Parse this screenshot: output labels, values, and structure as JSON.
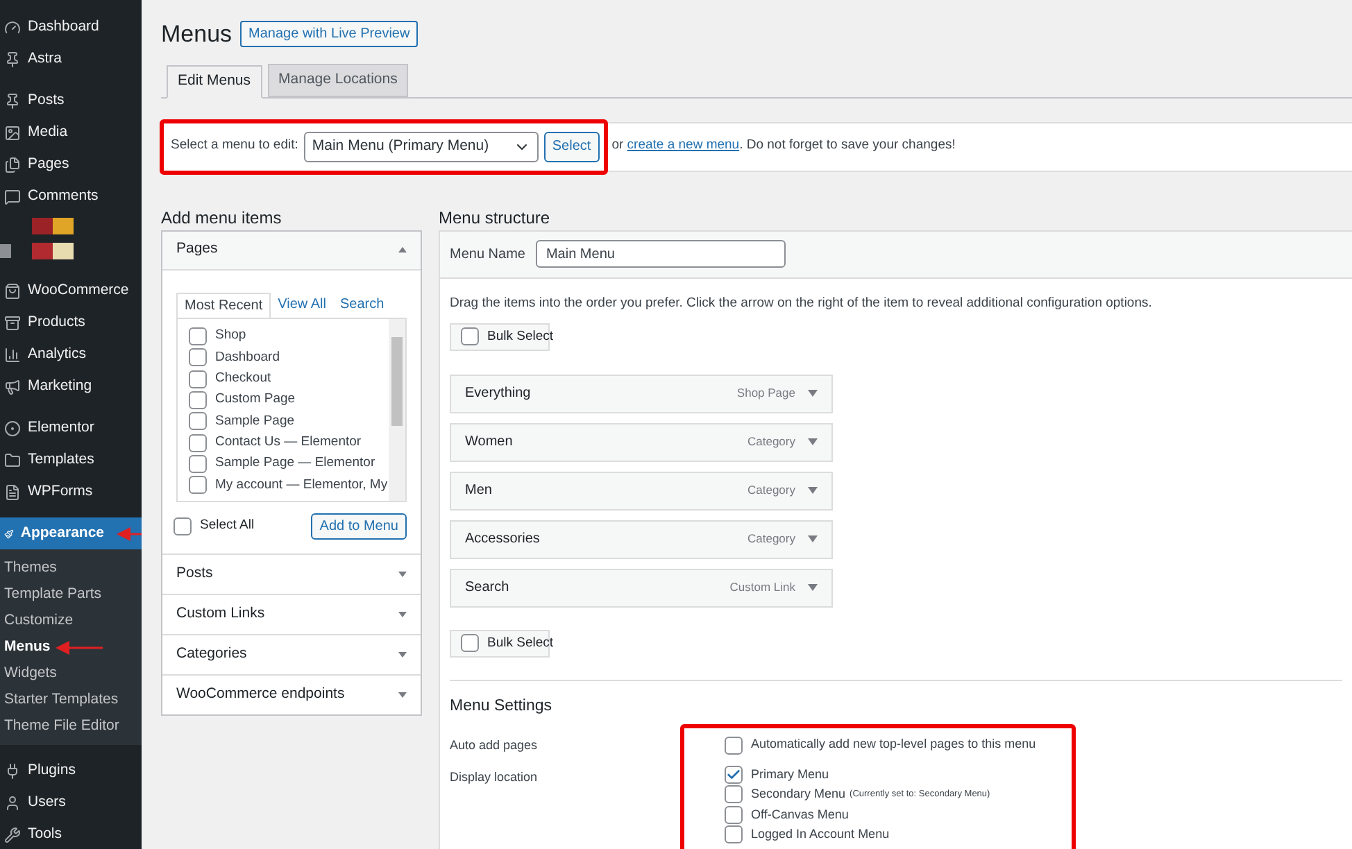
{
  "sidebar": {
    "sections": [
      [
        {
          "label": "Dashboard",
          "selected": false
        },
        {
          "label": "Astra",
          "selected": false
        }
      ],
      [
        {
          "label": "Posts",
          "selected": false
        },
        {
          "label": "Media",
          "selected": false
        },
        {
          "label": "Pages",
          "selected": false
        },
        {
          "label": "Comments",
          "selected": false
        }
      ],
      [
        {
          "label": "WooCommerce",
          "selected": false
        },
        {
          "label": "Products",
          "selected": false
        },
        {
          "label": "Analytics",
          "selected": false
        },
        {
          "label": "Marketing",
          "selected": false
        }
      ],
      [
        {
          "label": "Elementor",
          "selected": false
        },
        {
          "label": "Templates",
          "selected": false
        },
        {
          "label": "WPForms",
          "selected": false
        }
      ],
      [
        {
          "label": "Appearance",
          "selected": true,
          "arrow": true,
          "children": [
            {
              "label": "Themes",
              "selected": false,
              "arrow": false
            },
            {
              "label": "Template Parts",
              "selected": false,
              "arrow": false
            },
            {
              "label": "Customize",
              "selected": false,
              "arrow": false
            },
            {
              "label": "Menus",
              "selected": true,
              "arrow": true
            },
            {
              "label": "Widgets",
              "selected": false,
              "arrow": false
            },
            {
              "label": "Starter Templates",
              "selected": false,
              "arrow": false
            },
            {
              "label": "Theme File Editor",
              "selected": false,
              "arrow": false
            }
          ]
        }
      ],
      [
        {
          "label": "Plugins",
          "selected": false
        },
        {
          "label": "Users",
          "selected": false
        },
        {
          "label": "Tools",
          "selected": false
        }
      ]
    ]
  },
  "page": {
    "title": "Menus",
    "action_button": "Manage with Live Preview"
  },
  "tabs": [
    {
      "label": "Edit Menus",
      "selected": true
    },
    {
      "label": "Manage Locations",
      "selected": false
    }
  ],
  "select_bar": {
    "highlighted": true,
    "label": "Select a menu to edit:",
    "value": "Main Menu (Primary Menu)",
    "button": "Select",
    "text_before": "or",
    "link": "create a new menu",
    "text_after": ". Do not forget to save your changes!"
  },
  "add_items": {
    "heading": "Add menu items",
    "pages_panel": {
      "title": "Pages",
      "expanded": true,
      "tabs": [
        {
          "label": "Most Recent",
          "selected": true
        },
        {
          "label": "View All",
          "selected": false
        },
        {
          "label": "Search",
          "selected": false
        }
      ],
      "items": [
        {
          "label": "Shop",
          "checked": false
        },
        {
          "label": "Dashboard",
          "checked": false
        },
        {
          "label": "Checkout",
          "checked": false
        },
        {
          "label": "Custom Page",
          "checked": false
        },
        {
          "label": "Sample Page",
          "checked": false
        },
        {
          "label": "Contact Us — Elementor",
          "checked": false
        },
        {
          "label": "Sample Page — Elementor",
          "checked": false
        },
        {
          "label": "My account — Elementor, My",
          "checked": false
        }
      ],
      "select_all": {
        "label": "Select All",
        "checked": false
      },
      "add_button": "Add to Menu"
    },
    "panels": [
      {
        "title": "Posts",
        "expanded": false
      },
      {
        "title": "Custom Links",
        "expanded": false
      },
      {
        "title": "Categories",
        "expanded": false
      },
      {
        "title": "WooCommerce endpoints",
        "expanded": false
      }
    ]
  },
  "structure": {
    "heading": "Menu structure",
    "name_label": "Menu Name",
    "name_value": "Main Menu",
    "hint": "Drag the items into the order you prefer. Click the arrow on the right of the item to reveal additional configuration options.",
    "bulk_select_top": {
      "label": "Bulk Select",
      "checked": false
    },
    "items": [
      {
        "title": "Everything",
        "type": "Shop Page"
      },
      {
        "title": "Women",
        "type": "Category"
      },
      {
        "title": "Men",
        "type": "Category"
      },
      {
        "title": "Accessories",
        "type": "Category"
      },
      {
        "title": "Search",
        "type": "Custom Link"
      }
    ],
    "bulk_select_bottom": {
      "label": "Bulk Select",
      "checked": false
    }
  },
  "settings": {
    "heading": "Menu Settings",
    "highlighted": true,
    "auto_add_label": "Auto add pages",
    "auto_add": {
      "label": "Automatically add new top-level pages to this menu",
      "checked": false
    },
    "location_label": "Display location",
    "locations": [
      {
        "label": "Primary Menu",
        "checked": true
      },
      {
        "label": "Secondary Menu",
        "note": "(Currently set to: Secondary Menu)",
        "checked": false
      },
      {
        "label": "Off-Canvas Menu",
        "checked": false
      },
      {
        "label": "Logged In Account Menu",
        "checked": false
      }
    ]
  }
}
